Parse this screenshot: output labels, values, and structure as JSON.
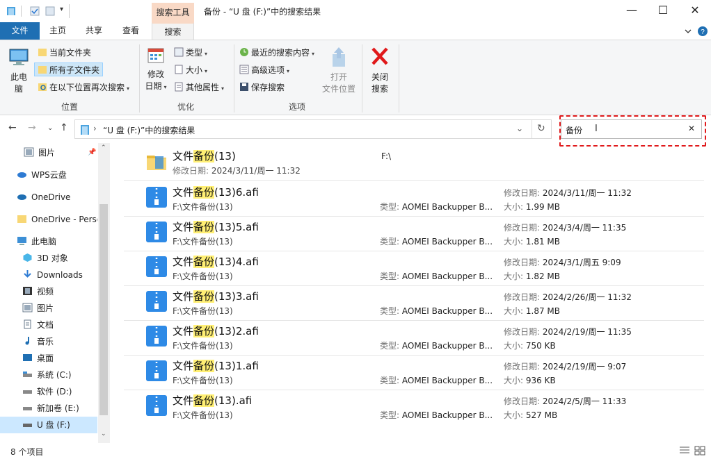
{
  "window": {
    "title": "备份 - “U 盘 (F:)”中的搜索结果",
    "tools_tab": "搜索工具",
    "minimize": "—",
    "maximize": "☐",
    "close": "✕"
  },
  "tabs": [
    {
      "label": "文件"
    },
    {
      "label": "主页"
    },
    {
      "label": "共享"
    },
    {
      "label": "查看"
    },
    {
      "label": "搜索"
    }
  ],
  "ribbon": {
    "location": {
      "this_pc": "此电\n脑",
      "this_pc_l1": "此电",
      "this_pc_l2": "脑",
      "current_folder": "当前文件夹",
      "all_subfolders": "所有子文件夹",
      "search_again": "在以下位置再次搜索",
      "group": "位置"
    },
    "refine": {
      "date_modified_l1": "修改",
      "date_modified_l2": "日期",
      "kind": "类型",
      "size": "大小",
      "other_props": "其他属性",
      "group": "优化"
    },
    "options": {
      "recent": "最近的搜索内容",
      "advanced": "高级选项",
      "save": "保存搜索",
      "open_loc_l1": "打开",
      "open_loc_l2": "文件位置",
      "group": "选项"
    },
    "close": {
      "l1": "关闭",
      "l2": "搜索"
    }
  },
  "address": {
    "path": "“U 盘 (F:)”中的搜索结果"
  },
  "search": {
    "query": "备份"
  },
  "sidebar": {
    "items": [
      {
        "label": "图片",
        "icon": "pictures-icon"
      },
      {
        "label": "WPS云盘",
        "icon": "cloud-icon"
      },
      {
        "label": "OneDrive",
        "icon": "onedrive-icon"
      },
      {
        "label": "OneDrive - Perso",
        "icon": "folder-icon"
      },
      {
        "label": "此电脑",
        "icon": "computer-icon"
      },
      {
        "label": "3D 对象",
        "icon": "3d-objects-icon"
      },
      {
        "label": "Downloads",
        "icon": "download-icon"
      },
      {
        "label": "视频",
        "icon": "video-icon"
      },
      {
        "label": "图片",
        "icon": "pictures-icon"
      },
      {
        "label": "文档",
        "icon": "documents-icon"
      },
      {
        "label": "音乐",
        "icon": "music-icon"
      },
      {
        "label": "桌面",
        "icon": "desktop-icon"
      },
      {
        "label": "系统 (C:)",
        "icon": "drive-icon"
      },
      {
        "label": "软件 (D:)",
        "icon": "drive-icon"
      },
      {
        "label": "新加卷 (E:)",
        "icon": "drive-icon"
      },
      {
        "label": "U 盘 (F:)",
        "icon": "usb-drive-icon"
      }
    ]
  },
  "labels": {
    "modified": "修改日期:",
    "type": "类型:",
    "size": "大小:"
  },
  "results": [
    {
      "name_pre": "文件",
      "name_hl": "备份",
      "name_post": "(13)",
      "is_folder": true,
      "sub": "2024/3/11/周一 11:32",
      "location": "F:\\"
    },
    {
      "name_pre": "文件",
      "name_hl": "备份",
      "name_post": "(13)6.afi",
      "sub": "F:\\文件备份(13)",
      "type": "AOMEI Backupper B...",
      "date": "2024/3/11/周一 11:32",
      "size": "1.99 MB"
    },
    {
      "name_pre": "文件",
      "name_hl": "备份",
      "name_post": "(13)5.afi",
      "sub": "F:\\文件备份(13)",
      "type": "AOMEI Backupper B...",
      "date": "2024/3/4/周一 11:35",
      "size": "1.81 MB"
    },
    {
      "name_pre": "文件",
      "name_hl": "备份",
      "name_post": "(13)4.afi",
      "sub": "F:\\文件备份(13)",
      "type": "AOMEI Backupper B...",
      "date": "2024/3/1/周五 9:09",
      "size": "1.82 MB"
    },
    {
      "name_pre": "文件",
      "name_hl": "备份",
      "name_post": "(13)3.afi",
      "sub": "F:\\文件备份(13)",
      "type": "AOMEI Backupper B...",
      "date": "2024/2/26/周一 11:32",
      "size": "1.87 MB"
    },
    {
      "name_pre": "文件",
      "name_hl": "备份",
      "name_post": "(13)2.afi",
      "sub": "F:\\文件备份(13)",
      "type": "AOMEI Backupper B...",
      "date": "2024/2/19/周一 11:35",
      "size": "750 KB"
    },
    {
      "name_pre": "文件",
      "name_hl": "备份",
      "name_post": "(13)1.afi",
      "sub": "F:\\文件备份(13)",
      "type": "AOMEI Backupper B...",
      "date": "2024/2/19/周一 9:07",
      "size": "936 KB"
    },
    {
      "name_pre": "文件",
      "name_hl": "备份",
      "name_post": "(13).afi",
      "sub": "F:\\文件备份(13)",
      "type": "AOMEI Backupper B...",
      "date": "2024/2/5/周一 11:33",
      "size": "527 MB"
    }
  ],
  "status": {
    "count": "8 个项目"
  },
  "colors": {
    "accent": "#1f6fb3",
    "tools_tab": "#f9d9c6",
    "highlight": "#ffef74",
    "annotation": "#e0191b"
  }
}
